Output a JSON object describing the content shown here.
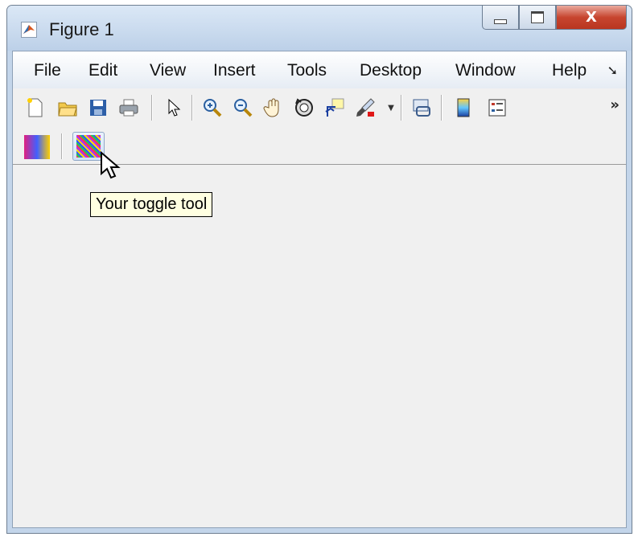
{
  "window": {
    "title": "Figure 1"
  },
  "caption_buttons": {
    "close_label": "X"
  },
  "menu": {
    "items": [
      "File",
      "Edit",
      "View",
      "Insert",
      "Tools",
      "Desktop",
      "Window",
      "Help"
    ],
    "more_icon": "chevron-icon"
  },
  "toolbar": {
    "more_label": "»",
    "tools": [
      "new-figure-icon",
      "open-file-icon",
      "save-icon",
      "print-icon",
      "select-arrow-icon",
      "zoom-in-icon",
      "zoom-out-icon",
      "pan-icon",
      "rotate-3d-icon",
      "data-cursor-icon",
      "brush-icon",
      "link-plot-icon",
      "colorbar-icon",
      "legend-icon"
    ]
  },
  "custom_toolbar": {
    "tools": [
      "colormap-tool-icon",
      "toggle-tool-icon"
    ]
  },
  "tooltip": {
    "text": "Your toggle tool"
  },
  "colors": {
    "titlebar": "#c3d5ea",
    "client": "#f0f0f0",
    "tooltip_bg": "#ffffe1",
    "close_button": "#c7452f"
  }
}
